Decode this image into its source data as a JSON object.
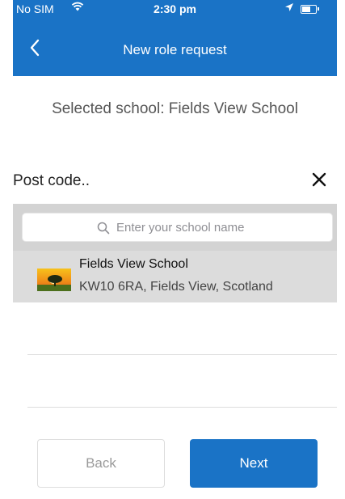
{
  "status_bar": {
    "carrier": "No SIM",
    "time": "2:30 pm"
  },
  "nav": {
    "title": "New role request"
  },
  "selected_school": {
    "text": "Selected school: Fields View School"
  },
  "postcode": {
    "label": "Post code.."
  },
  "search": {
    "placeholder": "Enter your school name",
    "value": ""
  },
  "results": [
    {
      "name": "Fields View School",
      "address": "KW10 6RA, Fields View, Scotland"
    }
  ],
  "buttons": {
    "back": "Back",
    "next": "Next"
  },
  "colors": {
    "primary": "#1a73c6",
    "panel": "#d3d3d3",
    "selected_row": "#dcdcdc"
  },
  "icons": {
    "wifi": "wifi-icon",
    "location": "location-arrow-icon",
    "battery": "battery-icon",
    "back": "chevron-left-icon",
    "close": "close-icon",
    "search": "search-icon",
    "thumbnail": "school-thumbnail-icon"
  }
}
